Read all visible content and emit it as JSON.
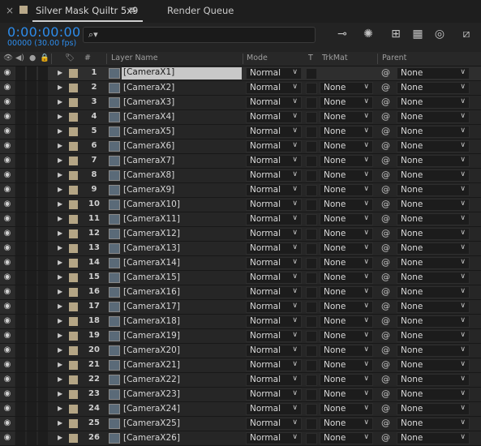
{
  "tabbar": {
    "close_label": "×",
    "comp_title": "Silver Mask Quiltr 5x9",
    "menu_label": "≡",
    "render_queue_label": "Render Queue",
    "swatch_color": "#b9a98a"
  },
  "header": {
    "timecode": "0:00:00:00",
    "frame_info": "00000 (30.00 fps)",
    "search_placeholder": "",
    "search_icon_label": "⌕▾",
    "icons": [
      "comp-flowchart-icon",
      "draft-3d-icon",
      "shy-layers-icon",
      "frame-blending-icon",
      "motion-blur-icon",
      "graph-editor-icon"
    ],
    "accent_color": "#2d8ceb"
  },
  "columns": {
    "layer_name": "Layer Name",
    "mode": "Mode",
    "t": "T",
    "trkmat": "TrkMat",
    "parent": "Parent",
    "hash": "#"
  },
  "rows": [
    {
      "num": "1",
      "name": "[CameraX1]",
      "mode": "Normal",
      "trkmat": "",
      "parent": "None",
      "selected": true
    },
    {
      "num": "2",
      "name": "[CameraX2]",
      "mode": "Normal",
      "trkmat": "None",
      "parent": "None"
    },
    {
      "num": "3",
      "name": "[CameraX3]",
      "mode": "Normal",
      "trkmat": "None",
      "parent": "None"
    },
    {
      "num": "4",
      "name": "[CameraX4]",
      "mode": "Normal",
      "trkmat": "None",
      "parent": "None"
    },
    {
      "num": "5",
      "name": "[CameraX5]",
      "mode": "Normal",
      "trkmat": "None",
      "parent": "None"
    },
    {
      "num": "6",
      "name": "[CameraX6]",
      "mode": "Normal",
      "trkmat": "None",
      "parent": "None"
    },
    {
      "num": "7",
      "name": "[CameraX7]",
      "mode": "Normal",
      "trkmat": "None",
      "parent": "None"
    },
    {
      "num": "8",
      "name": "[CameraX8]",
      "mode": "Normal",
      "trkmat": "None",
      "parent": "None"
    },
    {
      "num": "9",
      "name": "[CameraX9]",
      "mode": "Normal",
      "trkmat": "None",
      "parent": "None"
    },
    {
      "num": "10",
      "name": "[CameraX10]",
      "mode": "Normal",
      "trkmat": "None",
      "parent": "None"
    },
    {
      "num": "11",
      "name": "[CameraX11]",
      "mode": "Normal",
      "trkmat": "None",
      "parent": "None"
    },
    {
      "num": "12",
      "name": "[CameraX12]",
      "mode": "Normal",
      "trkmat": "None",
      "parent": "None"
    },
    {
      "num": "13",
      "name": "[CameraX13]",
      "mode": "Normal",
      "trkmat": "None",
      "parent": "None"
    },
    {
      "num": "14",
      "name": "[CameraX14]",
      "mode": "Normal",
      "trkmat": "None",
      "parent": "None"
    },
    {
      "num": "15",
      "name": "[CameraX15]",
      "mode": "Normal",
      "trkmat": "None",
      "parent": "None"
    },
    {
      "num": "16",
      "name": "[CameraX16]",
      "mode": "Normal",
      "trkmat": "None",
      "parent": "None"
    },
    {
      "num": "17",
      "name": "[CameraX17]",
      "mode": "Normal",
      "trkmat": "None",
      "parent": "None"
    },
    {
      "num": "18",
      "name": "[CameraX18]",
      "mode": "Normal",
      "trkmat": "None",
      "parent": "None"
    },
    {
      "num": "19",
      "name": "[CameraX19]",
      "mode": "Normal",
      "trkmat": "None",
      "parent": "None"
    },
    {
      "num": "20",
      "name": "[CameraX20]",
      "mode": "Normal",
      "trkmat": "None",
      "parent": "None"
    },
    {
      "num": "21",
      "name": "[CameraX21]",
      "mode": "Normal",
      "trkmat": "None",
      "parent": "None"
    },
    {
      "num": "22",
      "name": "[CameraX22]",
      "mode": "Normal",
      "trkmat": "None",
      "parent": "None"
    },
    {
      "num": "23",
      "name": "[CameraX23]",
      "mode": "Normal",
      "trkmat": "None",
      "parent": "None"
    },
    {
      "num": "24",
      "name": "[CameraX24]",
      "mode": "Normal",
      "trkmat": "None",
      "parent": "None"
    },
    {
      "num": "25",
      "name": "[CameraX25]",
      "mode": "Normal",
      "trkmat": "None",
      "parent": "None"
    },
    {
      "num": "26",
      "name": "[CameraX26]",
      "mode": "Normal",
      "trkmat": "None",
      "parent": "None"
    }
  ],
  "label_color": "#b4a585"
}
